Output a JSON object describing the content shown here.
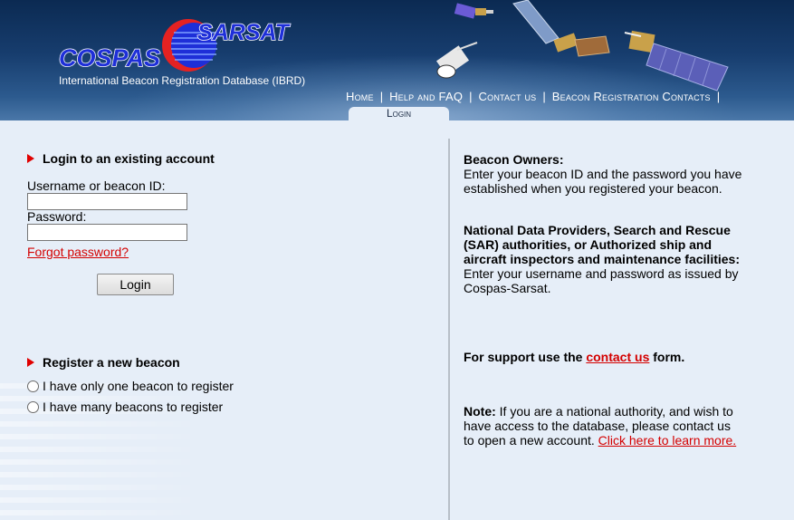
{
  "header": {
    "logo_cospas": "COSPAS",
    "logo_sarsat": "SARSAT",
    "subtitle": "International Beacon Registration Database (IBRD)",
    "nav": [
      "Home",
      "Help and FAQ",
      "Contact us",
      "Beacon Registration Contacts"
    ],
    "active_tab": "Login"
  },
  "login": {
    "title": "Login to an existing account",
    "username_label": "Username or beacon ID:",
    "username_value": "",
    "password_label": "Password:",
    "password_value": "",
    "forgot_link": "Forgot password?",
    "login_button": "Login"
  },
  "register": {
    "title": "Register a new beacon",
    "options": [
      "I have only one beacon to register",
      "I have many beacons to register"
    ]
  },
  "info": {
    "owners_heading": "Beacon Owners:",
    "owners_text": "Enter your beacon ID and the password you have established when you registered your beacon.",
    "providers_heading": "National Data Providers, Search and Rescue (SAR) authorities, or Authorized ship and aircraft inspectors and maintenance facilities:",
    "providers_text": "Enter your username and password as issued by Cospas-Sarsat.",
    "support_prefix": "For support use the",
    "support_link": "contact us",
    "support_suffix": "form.",
    "note_label": "Note:",
    "note_text": "If you are a national authority, and wish to have access to the database, please contact us to open a new account.",
    "note_link": "Click here to learn more."
  },
  "colors": {
    "header_dark": "#0b2a52",
    "accent_red": "#e00000",
    "link_red": "#d40000",
    "logo_blue": "#1e2fd8",
    "page_bg": "#e6eef8"
  }
}
